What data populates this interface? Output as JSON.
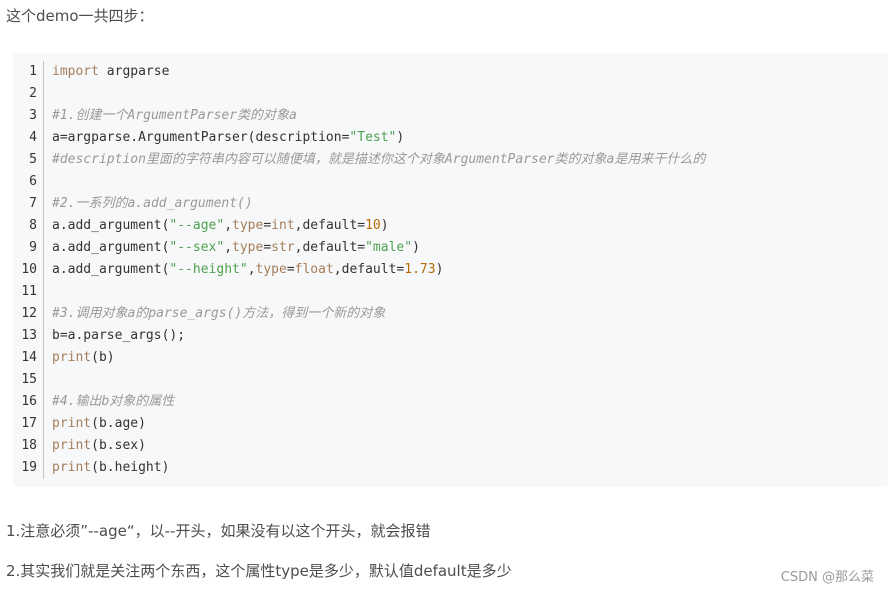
{
  "intro_text": "这个demo一共四步：",
  "code": {
    "lines": [
      {
        "num": "1",
        "tokens": [
          {
            "t": "import",
            "k": "kw"
          },
          {
            "t": " argparse",
            "k": ""
          }
        ]
      },
      {
        "num": "2",
        "tokens": []
      },
      {
        "num": "3",
        "tokens": [
          {
            "t": "#1.创建一个ArgumentParser类的对象a",
            "k": "comment"
          }
        ]
      },
      {
        "num": "4",
        "tokens": [
          {
            "t": "a=argparse.ArgumentParser(description=",
            "k": ""
          },
          {
            "t": "\"Test\"",
            "k": "str"
          },
          {
            "t": ")",
            "k": ""
          }
        ]
      },
      {
        "num": "5",
        "tokens": [
          {
            "t": "#description里面的字符串内容可以随便填，就是描述你这个对象ArgumentParser类的对象a是用来干什么的",
            "k": "comment"
          }
        ]
      },
      {
        "num": "6",
        "tokens": []
      },
      {
        "num": "7",
        "tokens": [
          {
            "t": "#2.一系列的a.add_argument()",
            "k": "comment"
          }
        ]
      },
      {
        "num": "8",
        "tokens": [
          {
            "t": "a.add_argument(",
            "k": ""
          },
          {
            "t": "\"--age\"",
            "k": "str"
          },
          {
            "t": ",",
            "k": ""
          },
          {
            "t": "type",
            "k": "kw"
          },
          {
            "t": "=",
            "k": ""
          },
          {
            "t": "int",
            "k": "fn"
          },
          {
            "t": ",default=",
            "k": ""
          },
          {
            "t": "10",
            "k": "num"
          },
          {
            "t": ")",
            "k": ""
          }
        ]
      },
      {
        "num": "9",
        "tokens": [
          {
            "t": "a.add_argument(",
            "k": ""
          },
          {
            "t": "\"--sex\"",
            "k": "str"
          },
          {
            "t": ",",
            "k": ""
          },
          {
            "t": "type",
            "k": "kw"
          },
          {
            "t": "=",
            "k": ""
          },
          {
            "t": "str",
            "k": "fn"
          },
          {
            "t": ",default=",
            "k": ""
          },
          {
            "t": "\"male\"",
            "k": "str"
          },
          {
            "t": ")",
            "k": ""
          }
        ]
      },
      {
        "num": "10",
        "tokens": [
          {
            "t": "a.add_argument(",
            "k": ""
          },
          {
            "t": "\"--height\"",
            "k": "str"
          },
          {
            "t": ",",
            "k": ""
          },
          {
            "t": "type",
            "k": "kw"
          },
          {
            "t": "=",
            "k": ""
          },
          {
            "t": "float",
            "k": "fn"
          },
          {
            "t": ",default=",
            "k": ""
          },
          {
            "t": "1.73",
            "k": "num"
          },
          {
            "t": ")",
            "k": ""
          }
        ]
      },
      {
        "num": "11",
        "tokens": []
      },
      {
        "num": "12",
        "tokens": [
          {
            "t": "#3.调用对象a的parse_args()方法，得到一个新的对象",
            "k": "comment"
          }
        ]
      },
      {
        "num": "13",
        "tokens": [
          {
            "t": "b=a.parse_args();",
            "k": ""
          }
        ]
      },
      {
        "num": "14",
        "tokens": [
          {
            "t": "print",
            "k": "fn"
          },
          {
            "t": "(b)",
            "k": ""
          }
        ]
      },
      {
        "num": "15",
        "tokens": []
      },
      {
        "num": "16",
        "tokens": [
          {
            "t": "#4.输出b对象的属性",
            "k": "comment"
          }
        ]
      },
      {
        "num": "17",
        "tokens": [
          {
            "t": "print",
            "k": "fn"
          },
          {
            "t": "(b.age)",
            "k": ""
          }
        ]
      },
      {
        "num": "18",
        "tokens": [
          {
            "t": "print",
            "k": "fn"
          },
          {
            "t": "(b.sex)",
            "k": ""
          }
        ]
      },
      {
        "num": "19",
        "tokens": [
          {
            "t": "print",
            "k": "fn"
          },
          {
            "t": "(b.height)",
            "k": ""
          }
        ]
      }
    ]
  },
  "notes": {
    "note1": "1.注意必须”--age“，以--开头，如果没有以这个开头，就会报错",
    "note2": "2.其实我们就是关注两个东西，这个属性type是多少，默认值default是多少"
  },
  "watermark": "CSDN @那么菜"
}
